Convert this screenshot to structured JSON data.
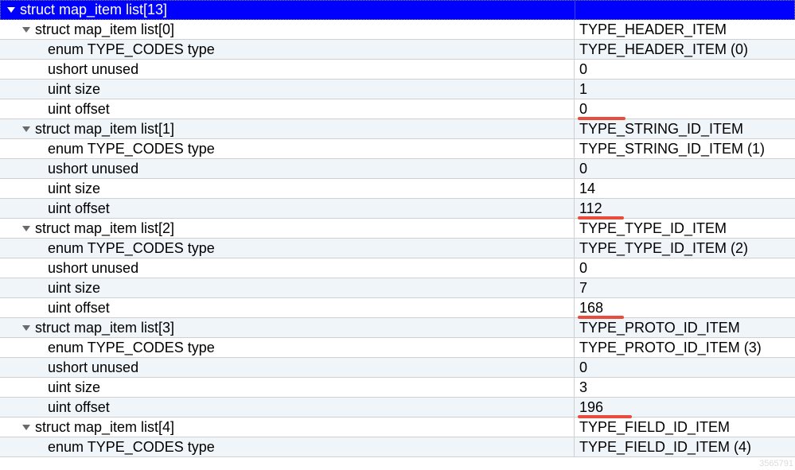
{
  "header": {
    "label": "struct map_item list[13]",
    "value": ""
  },
  "rows": [
    {
      "label": "struct map_item list[0]",
      "value": "TYPE_HEADER_ITEM",
      "indent": 1,
      "expandable": true
    },
    {
      "label": "enum TYPE_CODES type",
      "value": "TYPE_HEADER_ITEM (0)",
      "indent": 2,
      "expandable": false
    },
    {
      "label": "ushort unused",
      "value": "0",
      "indent": 2,
      "expandable": false
    },
    {
      "label": "uint size",
      "value": "1",
      "indent": 2,
      "expandable": false
    },
    {
      "label": "uint offset",
      "value": "0",
      "indent": 2,
      "expandable": false,
      "underline": 60
    },
    {
      "label": "struct map_item list[1]",
      "value": "TYPE_STRING_ID_ITEM",
      "indent": 1,
      "expandable": true
    },
    {
      "label": "enum TYPE_CODES type",
      "value": "TYPE_STRING_ID_ITEM (1)",
      "indent": 2,
      "expandable": false
    },
    {
      "label": "ushort unused",
      "value": "0",
      "indent": 2,
      "expandable": false
    },
    {
      "label": "uint size",
      "value": "14",
      "indent": 2,
      "expandable": false
    },
    {
      "label": "uint offset",
      "value": "112",
      "indent": 2,
      "expandable": false,
      "underline": 58
    },
    {
      "label": "struct map_item list[2]",
      "value": "TYPE_TYPE_ID_ITEM",
      "indent": 1,
      "expandable": true
    },
    {
      "label": "enum TYPE_CODES type",
      "value": "TYPE_TYPE_ID_ITEM (2)",
      "indent": 2,
      "expandable": false
    },
    {
      "label": "ushort unused",
      "value": "0",
      "indent": 2,
      "expandable": false
    },
    {
      "label": "uint size",
      "value": "7",
      "indent": 2,
      "expandable": false
    },
    {
      "label": "uint offset",
      "value": "168",
      "indent": 2,
      "expandable": false,
      "underline": 58
    },
    {
      "label": "struct map_item list[3]",
      "value": "TYPE_PROTO_ID_ITEM",
      "indent": 1,
      "expandable": true
    },
    {
      "label": "enum TYPE_CODES type",
      "value": "TYPE_PROTO_ID_ITEM (3)",
      "indent": 2,
      "expandable": false
    },
    {
      "label": "ushort unused",
      "value": "0",
      "indent": 2,
      "expandable": false
    },
    {
      "label": "uint size",
      "value": "3",
      "indent": 2,
      "expandable": false
    },
    {
      "label": "uint offset",
      "value": "196",
      "indent": 2,
      "expandable": false,
      "underline": 68
    },
    {
      "label": "struct map_item list[4]",
      "value": "TYPE_FIELD_ID_ITEM",
      "indent": 1,
      "expandable": true
    },
    {
      "label": "enum TYPE_CODES type",
      "value": "TYPE_FIELD_ID_ITEM (4)",
      "indent": 2,
      "expandable": false
    }
  ],
  "watermark": "3565791"
}
